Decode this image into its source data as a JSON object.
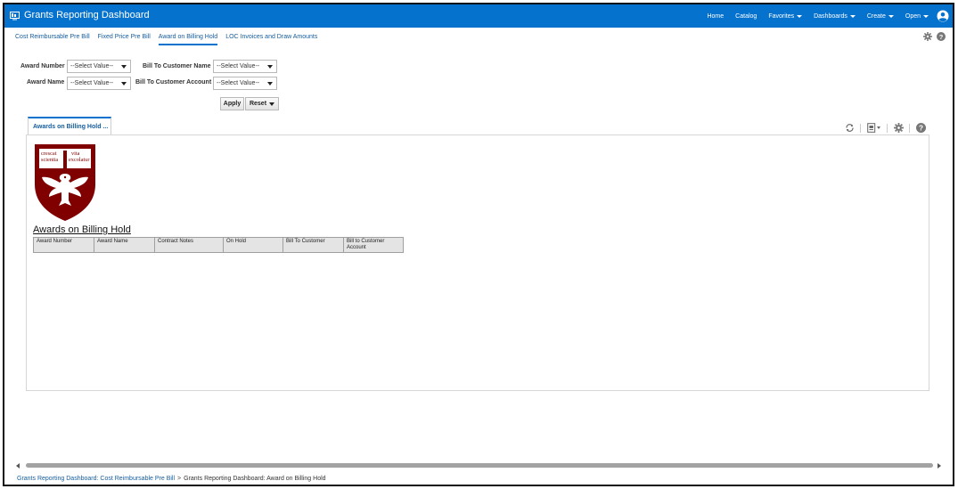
{
  "header": {
    "title": "Grants Reporting Dashboard",
    "nav": [
      {
        "label": "Home",
        "caret": false
      },
      {
        "label": "Catalog",
        "caret": false
      },
      {
        "label": "Favorites",
        "caret": true
      },
      {
        "label": "Dashboards",
        "caret": true
      },
      {
        "label": "Create",
        "caret": true
      },
      {
        "label": "Open",
        "caret": true
      }
    ],
    "accent": "#0572ce"
  },
  "page_tabs": [
    {
      "label": "Cost Reimbursable Pre Bill",
      "active": false
    },
    {
      "label": "Fixed Price Pre Bill",
      "active": false
    },
    {
      "label": "Award on Billing Hold",
      "active": true
    },
    {
      "label": "LOC Invoices and Draw Amounts",
      "active": false
    }
  ],
  "prompts": {
    "award_number_label": "Award Number",
    "award_number_value": "--Select Value--",
    "award_name_label": "Award Name",
    "award_name_value": "--Select Value--",
    "bill_to_customer_name_label": "Bill To Customer Name",
    "bill_to_customer_name_value": "--Select Value--",
    "bill_to_customer_account_label": "Bill To Customer Account",
    "bill_to_customer_account_value": "--Select Value--",
    "apply_label": "Apply",
    "reset_label": "Reset"
  },
  "analysis": {
    "tab_label": "Awards on Billing Hold ...",
    "report_title": "Awards on Billing Hold",
    "crest_color": "#800000",
    "crest_text": [
      "crescat",
      "scientia",
      "vita",
      "excolatur"
    ],
    "columns": [
      "Award Number",
      "Award Name",
      "Contract Notes",
      "On Hold",
      "Bill To Customer",
      "Bill to Customer Account"
    ]
  },
  "breadcrumb": {
    "link": "Grants Reporting Dashboard: Cost Reimbursable Pre Bill",
    "separator": ">",
    "current": "Grants Reporting Dashboard: Award on Billing Hold"
  }
}
